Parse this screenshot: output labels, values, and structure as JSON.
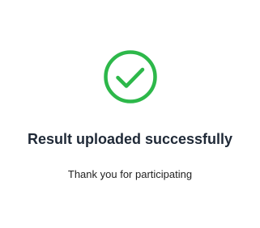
{
  "status": {
    "icon": "check-circle-icon",
    "icon_color": "#2db84a",
    "title": "Result uploaded successfully",
    "message": "Thank you for participating"
  }
}
